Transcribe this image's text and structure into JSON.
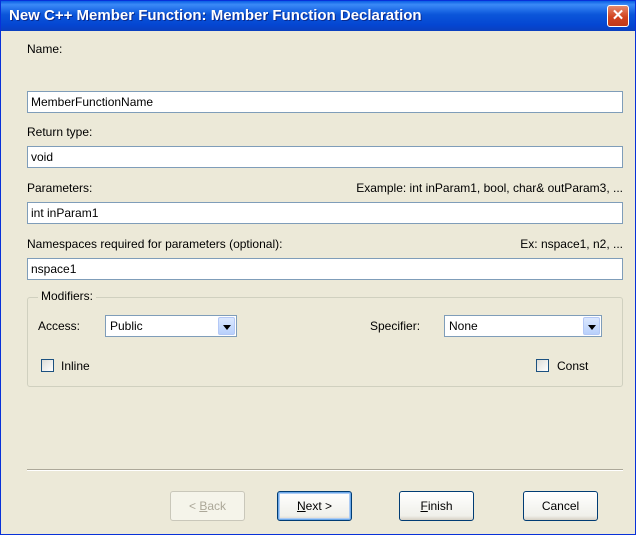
{
  "window": {
    "title": "New C++ Member Function: Member Function Declaration",
    "close_glyph": "✕"
  },
  "form": {
    "name_label": "Name:",
    "name_value": "MemberFunctionName",
    "return_type_label": "Return type:",
    "return_type_value": "void",
    "parameters_label": "Parameters:",
    "parameters_hint": "Example: int inParam1, bool, char& outParam3, ...",
    "parameters_value": "int inParam1",
    "namespaces_label": "Namespaces required for parameters (optional):",
    "namespaces_hint": "Ex: nspace1, n2, ...",
    "namespaces_value": "nspace1"
  },
  "modifiers": {
    "group_label": "Modifiers:",
    "access_label": "Access:",
    "access_value": "Public",
    "specifier_label": "Specifier:",
    "specifier_value": "None",
    "inline_label": "Inline",
    "inline_checked": false,
    "const_label": "Const",
    "const_checked": false
  },
  "buttons": {
    "back_prefix": "< ",
    "back_mnemonic": "B",
    "back_rest": "ack",
    "next_mnemonic": "N",
    "next_rest": "ext >",
    "finish_mnemonic": "F",
    "finish_rest": "inish",
    "cancel": "Cancel"
  }
}
